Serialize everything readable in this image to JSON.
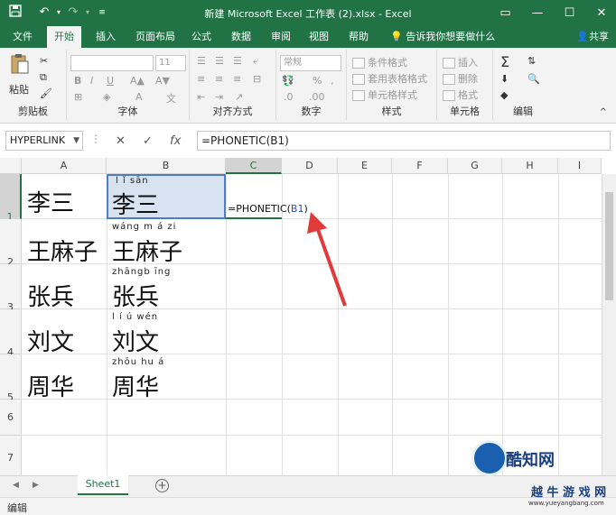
{
  "title_bar": {
    "title": "新建 Microsoft Excel 工作表 (2).xlsx  -  Excel",
    "save_icon": "save-icon",
    "undo_icon": "undo-icon",
    "redo_icon": "redo-icon",
    "window_controls": [
      "restore-ribbon-icon",
      "minimize-icon",
      "maximize-icon",
      "close-icon"
    ]
  },
  "ribbon_tabs": [
    "文件",
    "开始",
    "插入",
    "页面布局",
    "公式",
    "数据",
    "审阅",
    "视图",
    "帮助"
  ],
  "active_tab": "开始",
  "tell_me": "告诉我你想要做什么",
  "share": "共享",
  "ribbon": {
    "clipboard": {
      "label": "剪贴板",
      "paste": "粘贴"
    },
    "font": {
      "label": "字体",
      "size": "11",
      "bold": "B",
      "italic": "I",
      "underline": "U"
    },
    "alignment": {
      "label": "对齐方式"
    },
    "number": {
      "label": "数字",
      "format": "常规",
      "percent": "%"
    },
    "styles": {
      "label": "样式",
      "items": [
        "条件格式",
        "套用表格格式",
        "单元格样式"
      ]
    },
    "cells": {
      "label": "单元格",
      "items": [
        "插入",
        "删除",
        "格式"
      ]
    },
    "editing": {
      "label": "编辑"
    }
  },
  "formula_bar": {
    "name_box": "HYPERLINK",
    "formula": "=PHONETIC(B1)"
  },
  "columns": [
    "A",
    "B",
    "C",
    "D",
    "E",
    "F",
    "G",
    "H",
    "I"
  ],
  "rows": [
    "1",
    "2",
    "3",
    "4",
    "5",
    "6",
    "7"
  ],
  "cells": {
    "A": [
      "李三",
      "王麻子",
      "张兵",
      "刘文",
      "周华"
    ],
    "B": [
      "李三",
      "王麻子",
      "张兵",
      "刘文",
      "周华"
    ],
    "B_pinyin": [
      "l  ǐ sān",
      "wáng m  á  zi",
      "zhāngb  īng",
      "l í  ú wén",
      "zhōu hu á"
    ]
  },
  "c1": {
    "prefix": "=PHONETIC(",
    "ref": "B1",
    "suffix": ")"
  },
  "sheet_tabs": [
    "Sheet1"
  ],
  "status": "编辑",
  "watermark": {
    "brand": "酷知网",
    "sub": "越 牛 游 戏 网",
    "url": "www.yueyangbang.com"
  }
}
